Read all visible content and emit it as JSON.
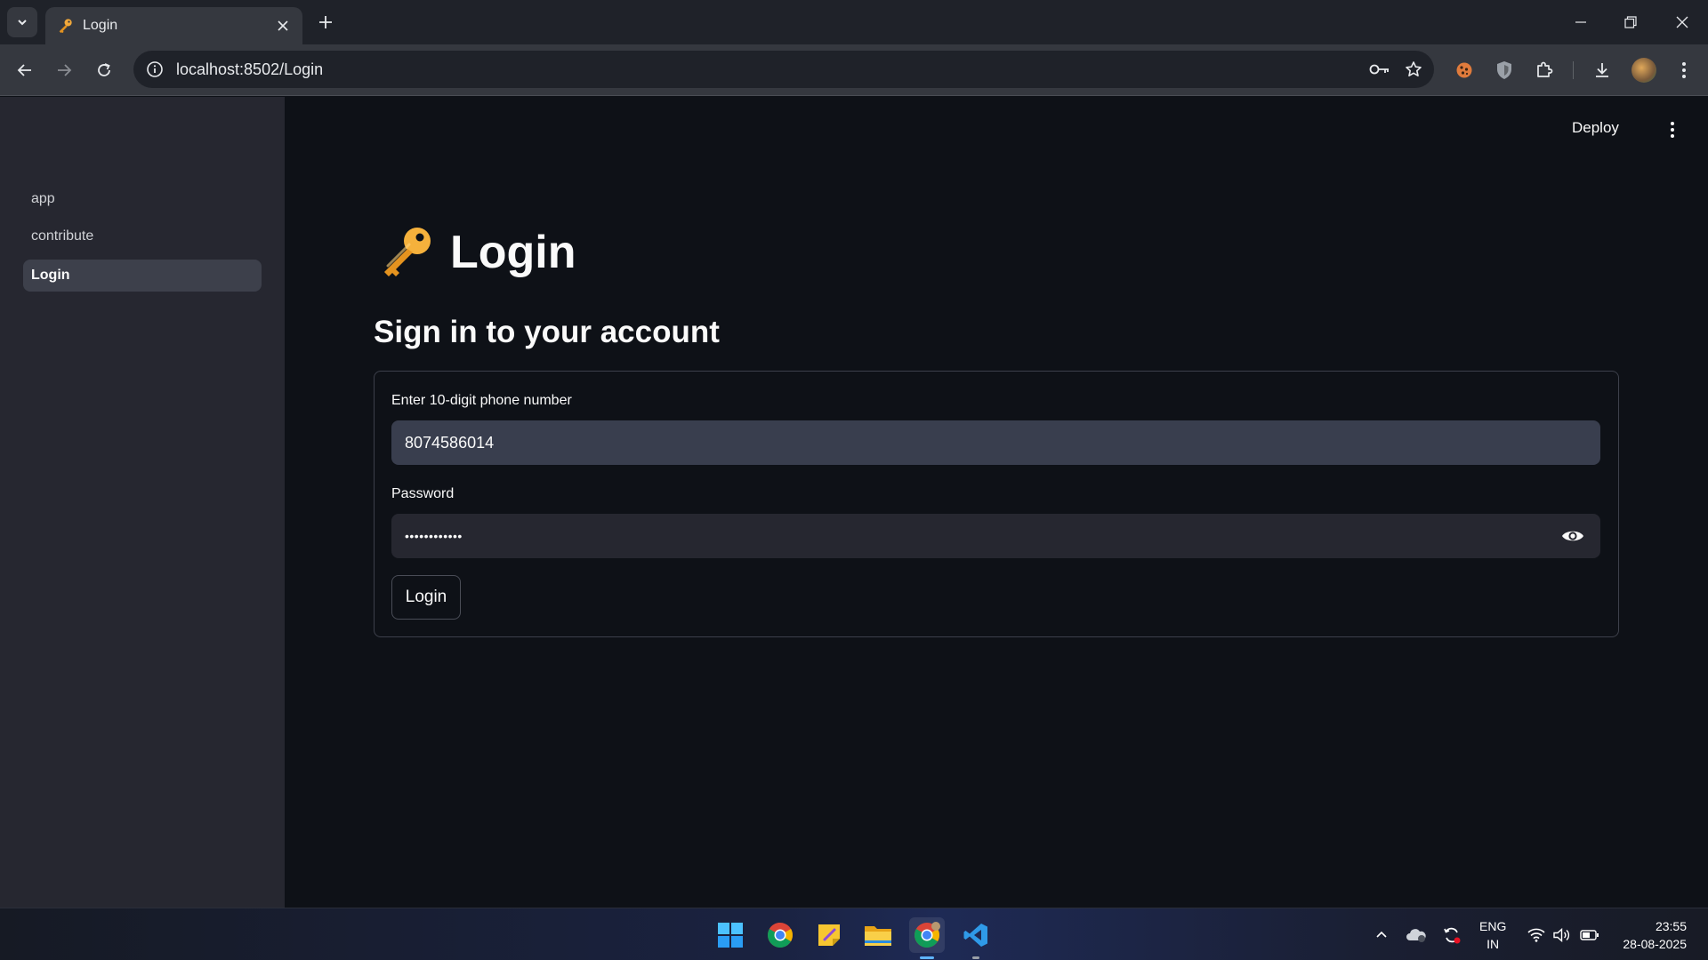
{
  "browser": {
    "tab_title": "Login",
    "url": "localhost:8502/Login"
  },
  "sidebar": {
    "items": [
      {
        "label": "app"
      },
      {
        "label": "contribute"
      },
      {
        "label": "Login"
      }
    ]
  },
  "header": {
    "deploy_label": "Deploy"
  },
  "main": {
    "title": "Login",
    "subtitle": "Sign in to your account",
    "phone_label": "Enter 10-digit phone number",
    "phone_value": "8074586014",
    "password_label": "Password",
    "password_value": "••••••••••••",
    "login_button": "Login"
  },
  "taskbar": {
    "lang_top": "ENG",
    "lang_bottom": "IN",
    "time": "23:55",
    "date": "28-08-2025"
  },
  "colors": {
    "background": "#0e1117",
    "sidebar": "#262730",
    "input": "#262730",
    "input_active": "#393e4e"
  }
}
